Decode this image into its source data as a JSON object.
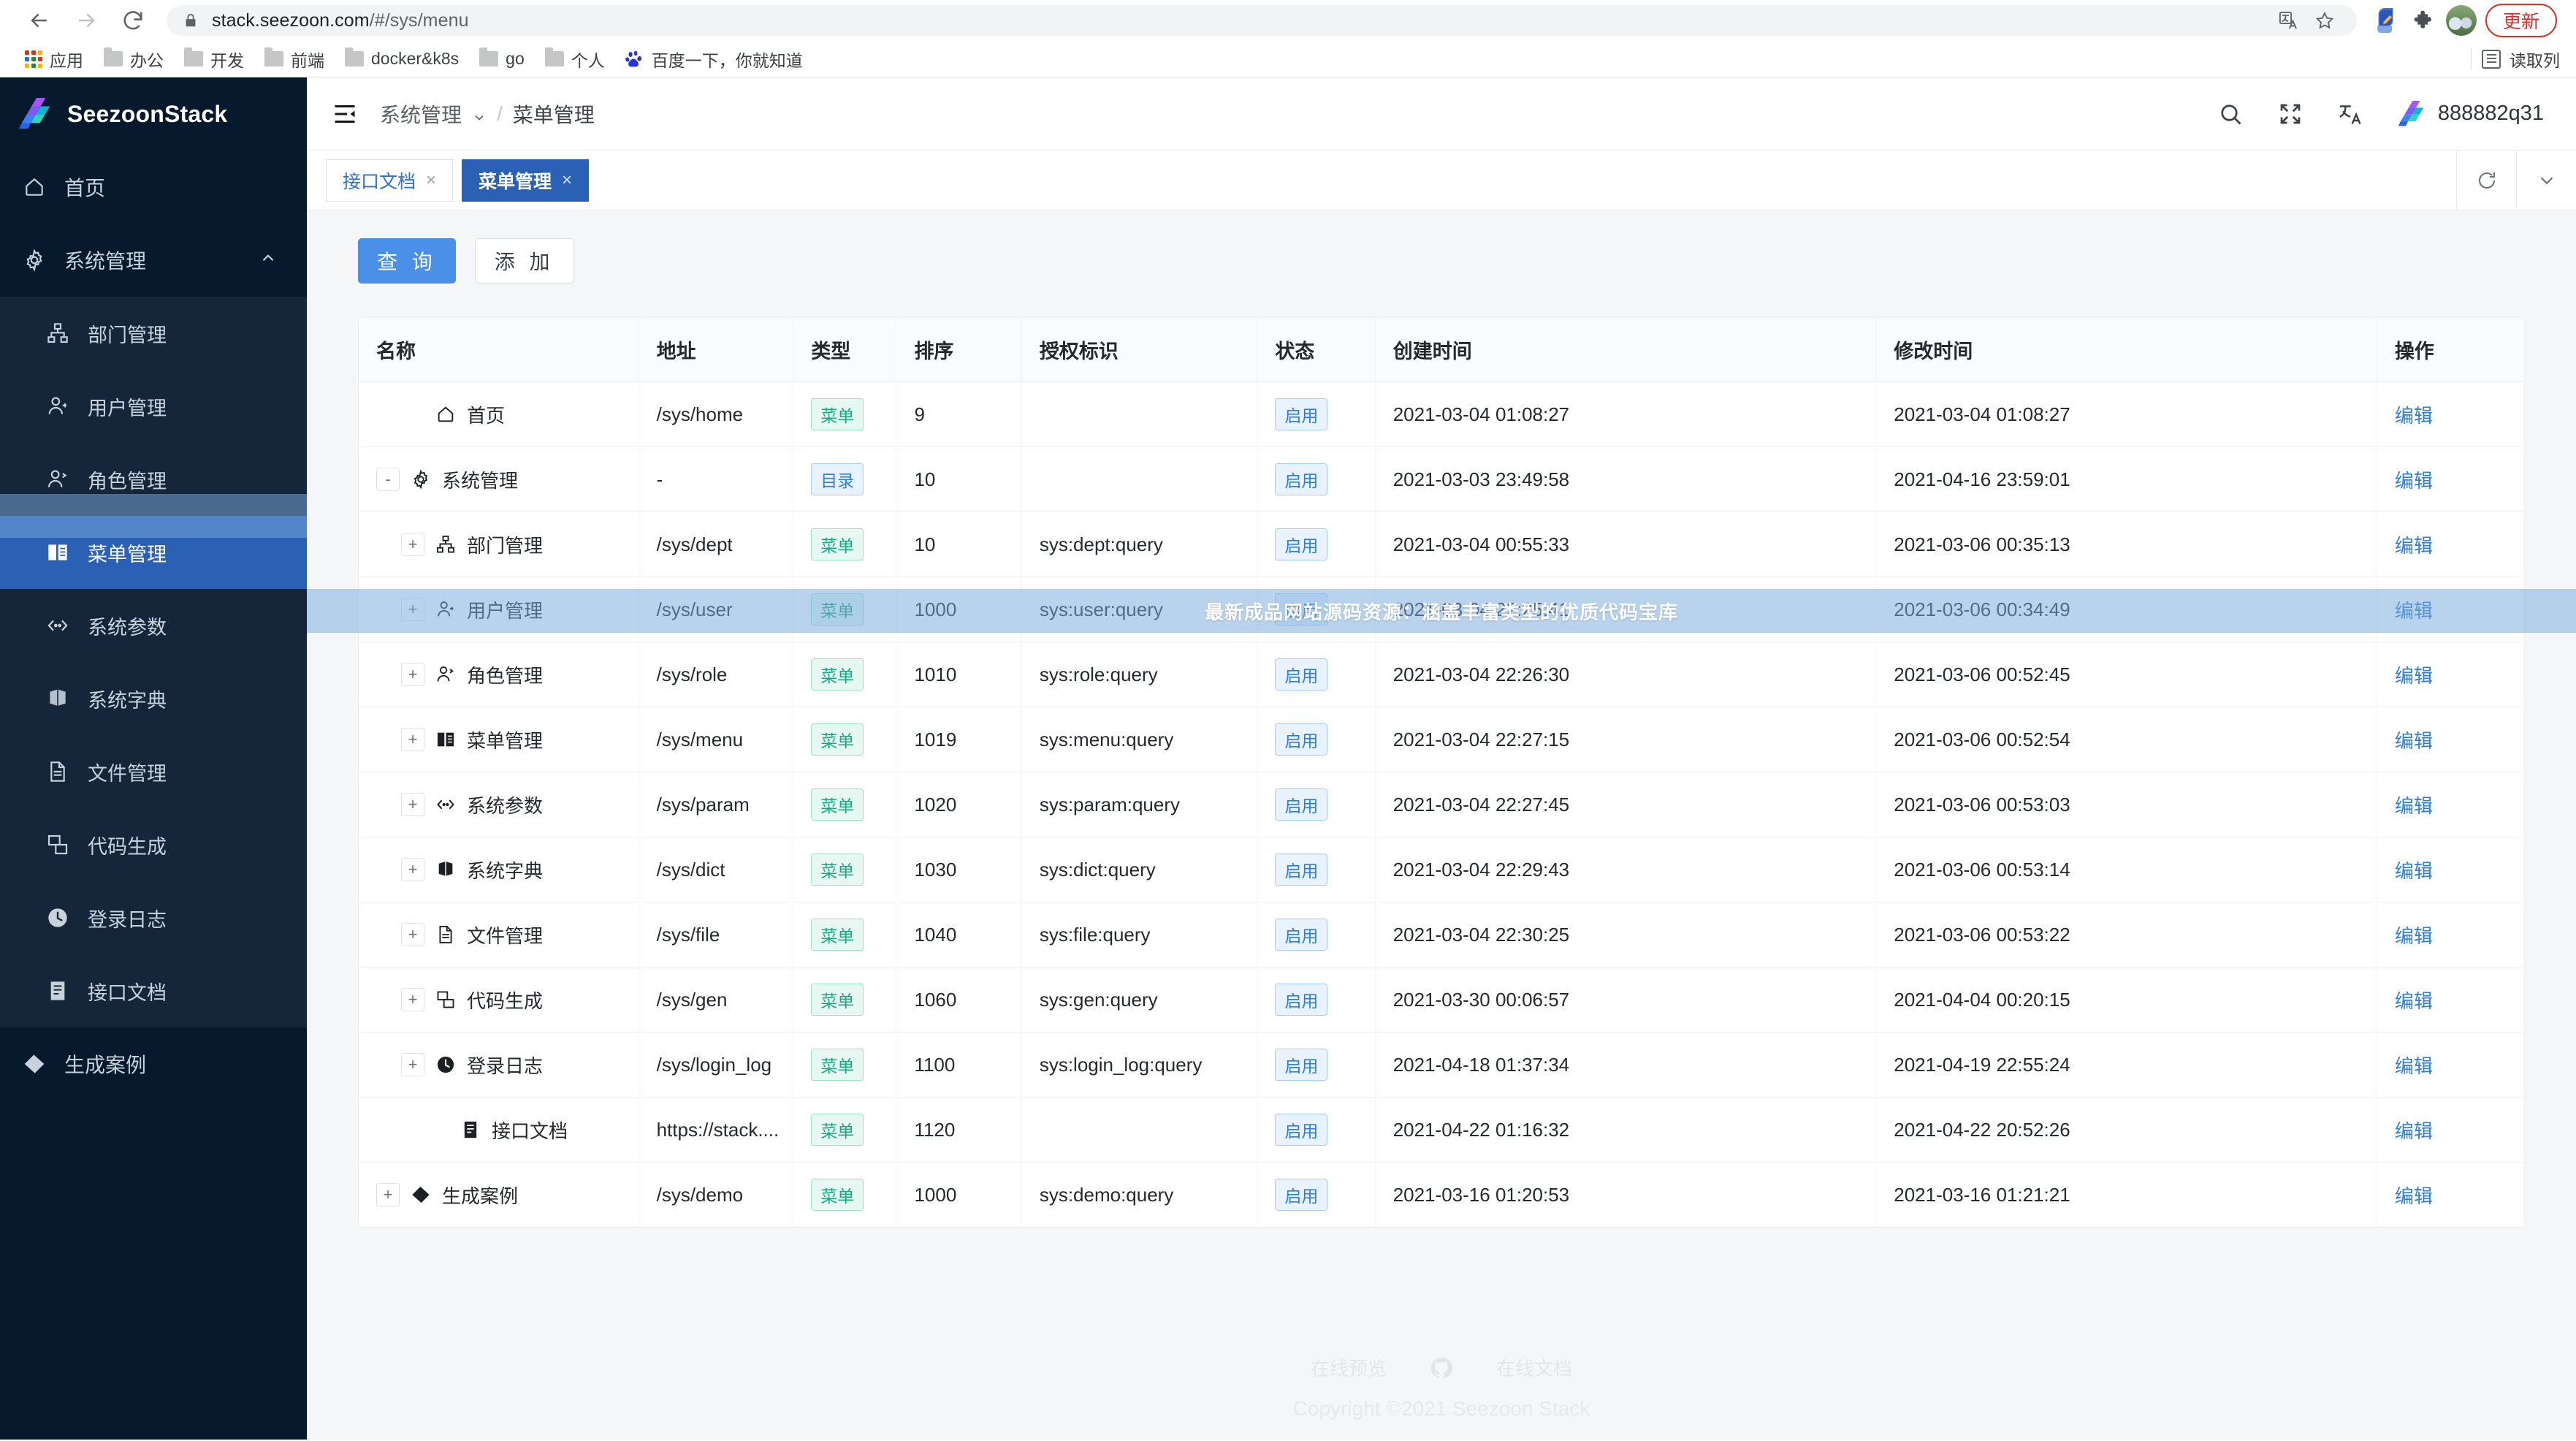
{
  "browser": {
    "url_main": "stack.seezoon.com",
    "url_path": "/#/sys/menu",
    "back_icon": "back-arrow-icon",
    "forward_icon": "forward-arrow-icon",
    "reload_icon": "reload-icon",
    "lock_icon": "lock-icon",
    "translate_icon": "translate-icon",
    "bookmark_star_icon": "star-icon",
    "extension_icon": "puzzle-piece-icon",
    "update_label": "更新",
    "bookmarks": [
      {
        "label": "应用",
        "icon": "apps-grid-icon"
      },
      {
        "label": "办公",
        "icon": "folder-icon"
      },
      {
        "label": "开发",
        "icon": "folder-icon"
      },
      {
        "label": "前端",
        "icon": "folder-icon"
      },
      {
        "label": "docker&k8s",
        "icon": "folder-icon"
      },
      {
        "label": "go",
        "icon": "folder-icon"
      },
      {
        "label": "个人",
        "icon": "folder-icon"
      },
      {
        "label": "百度一下，你就知道",
        "icon": "baidu-icon"
      }
    ],
    "reading_list_label": "读取列"
  },
  "sidebar": {
    "brand": "SeezoonStack",
    "items": [
      {
        "label": "首页",
        "icon": "home-icon",
        "active": false
      },
      {
        "label": "系统管理",
        "icon": "gear-icon",
        "active": false,
        "expanded": true
      }
    ],
    "submenu": [
      {
        "label": "部门管理",
        "icon": "org-tree-icon",
        "active": false
      },
      {
        "label": "用户管理",
        "icon": "user-icon",
        "active": false
      },
      {
        "label": "角色管理",
        "icon": "role-icon",
        "active": false
      },
      {
        "label": "菜单管理",
        "icon": "book-icon",
        "active": true
      },
      {
        "label": "系统参数",
        "icon": "code-brackets-icon",
        "active": false
      },
      {
        "label": "系统字典",
        "icon": "books-icon",
        "active": false
      },
      {
        "label": "文件管理",
        "icon": "file-icon",
        "active": false
      },
      {
        "label": "代码生成",
        "icon": "copy-icon",
        "active": false
      },
      {
        "label": "登录日志",
        "icon": "clock-icon",
        "active": false
      },
      {
        "label": "接口文档",
        "icon": "doc-icon",
        "active": false
      }
    ],
    "footer_items": [
      {
        "label": "生成案例",
        "icon": "tag-icon",
        "active": false
      }
    ]
  },
  "topbar": {
    "collapse_icon": "collapse-menu-icon",
    "breadcrumb": {
      "parent": "系统管理",
      "separator": "/",
      "current": "菜单管理"
    },
    "icons": [
      "search-icon",
      "fullscreen-icon",
      "language-icon"
    ],
    "user_name": "888882q31"
  },
  "tabs": [
    {
      "label": "接口文档",
      "close": "×",
      "active": false
    },
    {
      "label": "菜单管理",
      "close": "×",
      "active": true
    }
  ],
  "tab_controls": [
    "refresh-icon",
    "chevron-down-icon"
  ],
  "toolbar": {
    "query_label": "查 询",
    "add_label": "添 加"
  },
  "table": {
    "columns": [
      "名称",
      "地址",
      "类型",
      "排序",
      "授权标识",
      "状态",
      "创建时间",
      "修改时间",
      "操作"
    ],
    "action_label": "编辑",
    "rows": [
      {
        "toggle": "",
        "indent": 1,
        "icon": "home-icon",
        "name": "首页",
        "path": "/sys/home",
        "type": "菜单",
        "type_kind": "menu",
        "sort": "9",
        "perm": "",
        "status": "启用",
        "created": "2021-03-04 01:08:27",
        "modified": "2021-03-04 01:08:27"
      },
      {
        "toggle": "-",
        "indent": 0,
        "icon": "gear-icon",
        "name": "系统管理",
        "path": "-",
        "type": "目录",
        "type_kind": "dir",
        "sort": "10",
        "perm": "",
        "status": "启用",
        "created": "2021-03-03 23:49:58",
        "modified": "2021-04-16 23:59:01"
      },
      {
        "toggle": "+",
        "indent": 1,
        "icon": "org-tree-icon",
        "name": "部门管理",
        "path": "/sys/dept",
        "type": "菜单",
        "type_kind": "menu",
        "sort": "10",
        "perm": "sys:dept:query",
        "status": "启用",
        "created": "2021-03-04 00:55:33",
        "modified": "2021-03-06 00:35:13"
      },
      {
        "toggle": "+",
        "indent": 1,
        "icon": "user-icon",
        "name": "用户管理",
        "path": "/sys/user",
        "type": "菜单",
        "type_kind": "menu",
        "sort": "1000",
        "perm": "sys:user:query",
        "status": "启用",
        "created": "2021-03-04 22:25:41",
        "modified": "2021-03-06 00:34:49"
      },
      {
        "toggle": "+",
        "indent": 1,
        "icon": "role-icon",
        "name": "角色管理",
        "path": "/sys/role",
        "type": "菜单",
        "type_kind": "menu",
        "sort": "1010",
        "perm": "sys:role:query",
        "status": "启用",
        "created": "2021-03-04 22:26:30",
        "modified": "2021-03-06 00:52:45"
      },
      {
        "toggle": "+",
        "indent": 1,
        "icon": "book-icon",
        "name": "菜单管理",
        "path": "/sys/menu",
        "type": "菜单",
        "type_kind": "menu",
        "sort": "1019",
        "perm": "sys:menu:query",
        "status": "启用",
        "created": "2021-03-04 22:27:15",
        "modified": "2021-03-06 00:52:54"
      },
      {
        "toggle": "+",
        "indent": 1,
        "icon": "code-brackets-icon",
        "name": "系统参数",
        "path": "/sys/param",
        "type": "菜单",
        "type_kind": "menu",
        "sort": "1020",
        "perm": "sys:param:query",
        "status": "启用",
        "created": "2021-03-04 22:27:45",
        "modified": "2021-03-06 00:53:03"
      },
      {
        "toggle": "+",
        "indent": 1,
        "icon": "books-icon",
        "name": "系统字典",
        "path": "/sys/dict",
        "type": "菜单",
        "type_kind": "menu",
        "sort": "1030",
        "perm": "sys:dict:query",
        "status": "启用",
        "created": "2021-03-04 22:29:43",
        "modified": "2021-03-06 00:53:14"
      },
      {
        "toggle": "+",
        "indent": 1,
        "icon": "file-icon",
        "name": "文件管理",
        "path": "/sys/file",
        "type": "菜单",
        "type_kind": "menu",
        "sort": "1040",
        "perm": "sys:file:query",
        "status": "启用",
        "created": "2021-03-04 22:30:25",
        "modified": "2021-03-06 00:53:22"
      },
      {
        "toggle": "+",
        "indent": 1,
        "icon": "copy-icon",
        "name": "代码生成",
        "path": "/sys/gen",
        "type": "菜单",
        "type_kind": "menu",
        "sort": "1060",
        "perm": "sys:gen:query",
        "status": "启用",
        "created": "2021-03-30 00:06:57",
        "modified": "2021-04-04 00:20:15"
      },
      {
        "toggle": "+",
        "indent": 1,
        "icon": "clock-icon",
        "name": "登录日志",
        "path": "/sys/login_log",
        "type": "菜单",
        "type_kind": "menu",
        "sort": "1100",
        "perm": "sys:login_log:query",
        "status": "启用",
        "created": "2021-04-18 01:37:34",
        "modified": "2021-04-19 22:55:24"
      },
      {
        "toggle": "",
        "indent": 2,
        "icon": "doc-icon",
        "name": "接口文档",
        "path": "https://stack....",
        "type": "菜单",
        "type_kind": "menu",
        "sort": "1120",
        "perm": "",
        "status": "启用",
        "created": "2021-04-22 01:16:32",
        "modified": "2021-04-22 20:52:26"
      },
      {
        "toggle": "+",
        "indent": 0,
        "icon": "tag-icon",
        "name": "生成案例",
        "path": "/sys/demo",
        "type": "菜单",
        "type_kind": "menu",
        "sort": "1000",
        "perm": "sys:demo:query",
        "status": "启用",
        "created": "2021-03-16 01:20:53",
        "modified": "2021-03-16 01:21:21"
      }
    ]
  },
  "watermark": {
    "text": "最新成品网站源码资源：涵盖丰富类型的优质代码宝库"
  },
  "footer": {
    "preview_label": "在线预览",
    "github_icon": "github-icon",
    "docs_label": "在线文档",
    "copyright": "Copyright ©2021 Seezoon Stack"
  },
  "colors": {
    "sidebar_bg": "#071a2d",
    "submenu_bg": "#16263a",
    "accent_blue": "#2a61b5",
    "primary_button": "#4a90e8",
    "link_blue": "#2f7fd8",
    "tag_menu_green": "#1aa884",
    "update_red": "#d93025"
  }
}
